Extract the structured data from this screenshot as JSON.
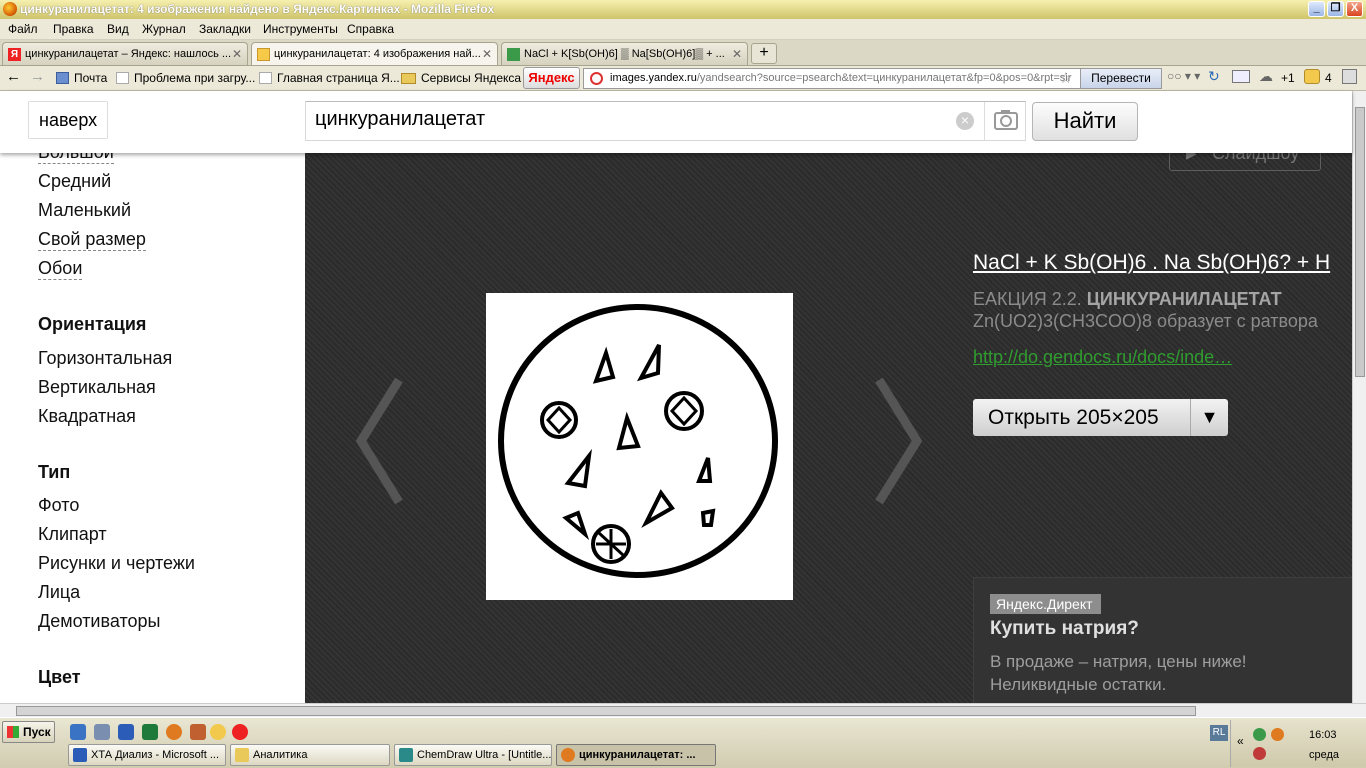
{
  "window": {
    "title": "цинкуранилацетат: 4 изображения найдено в Яндекс.Картинках - Mozilla Firefox",
    "buttons": [
      "_",
      "❐",
      "X"
    ]
  },
  "menu": [
    "Файл",
    "Правка",
    "Вид",
    "Журнал",
    "Закладки",
    "Инструменты",
    "Справка"
  ],
  "tabs": [
    {
      "label": "цинкуранилацетат – Яндекс: нашлось ...",
      "active": false
    },
    {
      "label": "цинкуранилацетат: 4 изображения най...",
      "active": true
    },
    {
      "label": "NaCl + K[Sb(OH)6] ▒ Na[Sb(OH)6]▒ + ...",
      "active": false
    }
  ],
  "newtab": "+",
  "bookmarks": {
    "mail": "Почта",
    "problem": "Проблема при загру...",
    "home": "Главная страница Я...",
    "services": "Сервисы Яндекса"
  },
  "yandex_button": "Яндекс",
  "url": {
    "domain": "images.yandex.ru",
    "path": "/yandsearch?source=psearch&text=цинкуранилацетат&fp=0&pos=0&rpt=sir"
  },
  "translate": "Перевести",
  "nav_extra": {
    "plus": "+1",
    "count": "4"
  },
  "header": {
    "up_button": "наверх",
    "search_value": "цинкуранилацетат",
    "find_button": "Найти"
  },
  "sidebar": {
    "size_big": "Большой",
    "size_medium": "Средний",
    "size_small": "Маленький",
    "size_custom": "Свой размер",
    "size_wallpaper": "Обои",
    "orientation_title": "Ориентация",
    "orientation_h": "Горизонтальная",
    "orientation_v": "Вертикальная",
    "orientation_sq": "Квадратная",
    "type_title": "Тип",
    "type_photo": "Фото",
    "type_clipart": "Клипарт",
    "type_drawings": "Рисунки и чертежи",
    "type_faces": "Лица",
    "type_demotivators": "Демотиваторы",
    "color_title": "Цвет"
  },
  "viewer": {
    "slideshow": "Слайдшоу",
    "result_title": "NaCl + K Sb(OH)6 . Na Sb(OH)6? + H",
    "desc_prefix": "ЕАКЦИЯ 2.2. ",
    "desc_bold": "ЦИНКУРАНИЛАЦЕТАТ",
    "desc_line2": "Zn(UO2)3(CH3COO)8 образует с ратвора",
    "link": "http://do.gendocs.ru/docs/inde…",
    "open_button": "Открыть 205×205",
    "open_dropdown": "▼",
    "direct_badge": "Яндекс.Директ",
    "direct_title": "Купить натрия?",
    "direct_line1": "В продаже – натрия, цены ниже!",
    "direct_line2": "Неликвидные остатки."
  },
  "taskbar": {
    "start": "Пуск",
    "tasks": [
      {
        "label": "ХТА Диализ - Microsoft ...",
        "active": false
      },
      {
        "label": "Аналитика",
        "active": false
      },
      {
        "label": "ChemDraw Ultra - [Untitle...",
        "active": false
      },
      {
        "label": "цинкуранилацетат: ...",
        "active": true
      }
    ],
    "lang": "RL",
    "time": "16:03",
    "day": "среда"
  }
}
